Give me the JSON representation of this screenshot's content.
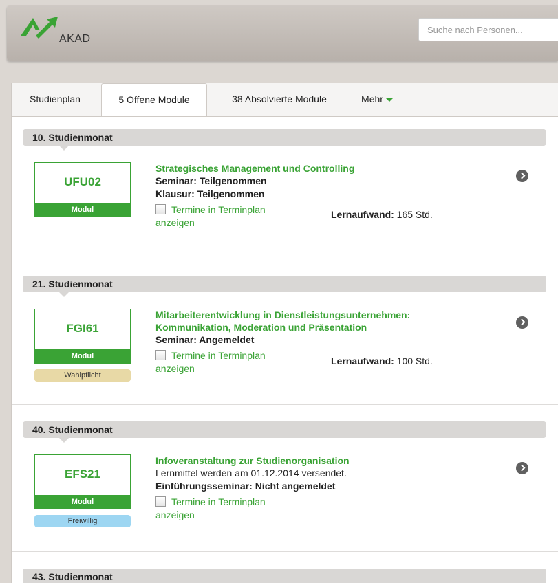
{
  "header": {
    "logo_text": "AKAD",
    "search_placeholder": "Suche nach Personen..."
  },
  "tabs": [
    {
      "label": "Studienplan"
    },
    {
      "label": "5 Offene Module"
    },
    {
      "label": "38 Absolvierte Module"
    },
    {
      "label": "Mehr"
    }
  ],
  "colors": {
    "accent": "#3aa335",
    "wahlpflicht": "#e8d9a6",
    "freiwillig": "#9dd6f2"
  },
  "modules": [
    {
      "month": "10. Studienmonat",
      "code": "UFU02",
      "type": "Modul",
      "badge": "",
      "title": "Strategisches Management und Controlling",
      "lines": [
        {
          "label": "Seminar:",
          "value": "Teilgenommen"
        },
        {
          "label": "Klausur:",
          "value": "Teilgenommen"
        }
      ],
      "termine": "Termine in Terminplan",
      "termine2": "anzeigen",
      "lern_label": "Lernaufwand:",
      "lern_value": "165 Std."
    },
    {
      "month": "21. Studienmonat",
      "code": "FGI61",
      "type": "Modul",
      "badge": "Wahlpflicht",
      "title": "Mitarbeiterentwicklung in Dienstleistungsunternehmen: Kommunikation, Moderation und Präsentation",
      "lines": [
        {
          "label": "Seminar:",
          "value": "Angemeldet"
        }
      ],
      "termine": "Termine in Terminplan",
      "termine2": "anzeigen",
      "lern_label": "Lernaufwand:",
      "lern_value": "100 Std."
    },
    {
      "month": "40. Studienmonat",
      "code": "EFS21",
      "type": "Modul",
      "badge": "Freiwillig",
      "title": "Infoveranstaltung zur Studienorganisation",
      "note": "Lernmittel werden am 01.12.2014 versendet.",
      "lines": [
        {
          "label": "Einführungsseminar:",
          "value": "Nicht angemeldet"
        }
      ],
      "termine": "Termine in Terminplan",
      "termine2": "anzeigen"
    },
    {
      "month": "43. Studienmonat"
    }
  ]
}
